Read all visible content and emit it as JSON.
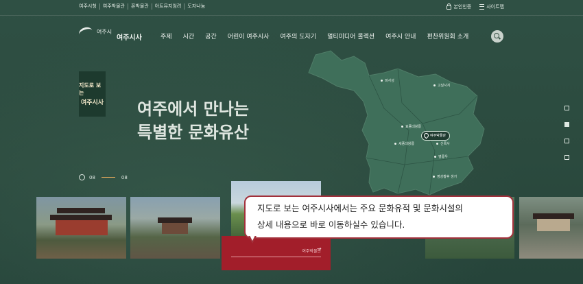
{
  "utility": {
    "links": [
      "여주시청",
      "여주박물관",
      "폰박물관",
      "아트뮤지엄려",
      "도자나눔"
    ],
    "login_label": "본인인증",
    "sitemap_label": "사이트맵"
  },
  "header": {
    "logo_text": "여주시",
    "site_title": "여주시사",
    "nav": [
      "주제",
      "시간",
      "공간",
      "어린이 여주시사",
      "여주의 도자기",
      "멀티미디어 콜렉션",
      "여주시 안내",
      "편찬위원회 소개"
    ]
  },
  "hero": {
    "badge_line1": "지도로 보는",
    "badge_line2": "여주시사",
    "title_line1": "여주에서 만나는",
    "title_line2": "특별한 문화유산"
  },
  "pager": {
    "current": "08",
    "total": "08"
  },
  "map": {
    "labels": [
      "파사성",
      "고달사지",
      "효종대왕릉",
      "세종대왕릉",
      "신륵사",
      "영릉우",
      "영성황후 생가"
    ],
    "highlight": "여주박물관"
  },
  "cards": {
    "active_label": "여주박물관"
  },
  "tooltip": {
    "text_line1": "지도로 보는 여주시사에서는 주요 문화유적 및 문화시설의",
    "text_line2": "상세 내용으로 바로 이동하실수 있습니다."
  },
  "colors": {
    "background": "#2d4c40",
    "accent": "#a21e2a",
    "tooltip_border": "#a2303b"
  }
}
